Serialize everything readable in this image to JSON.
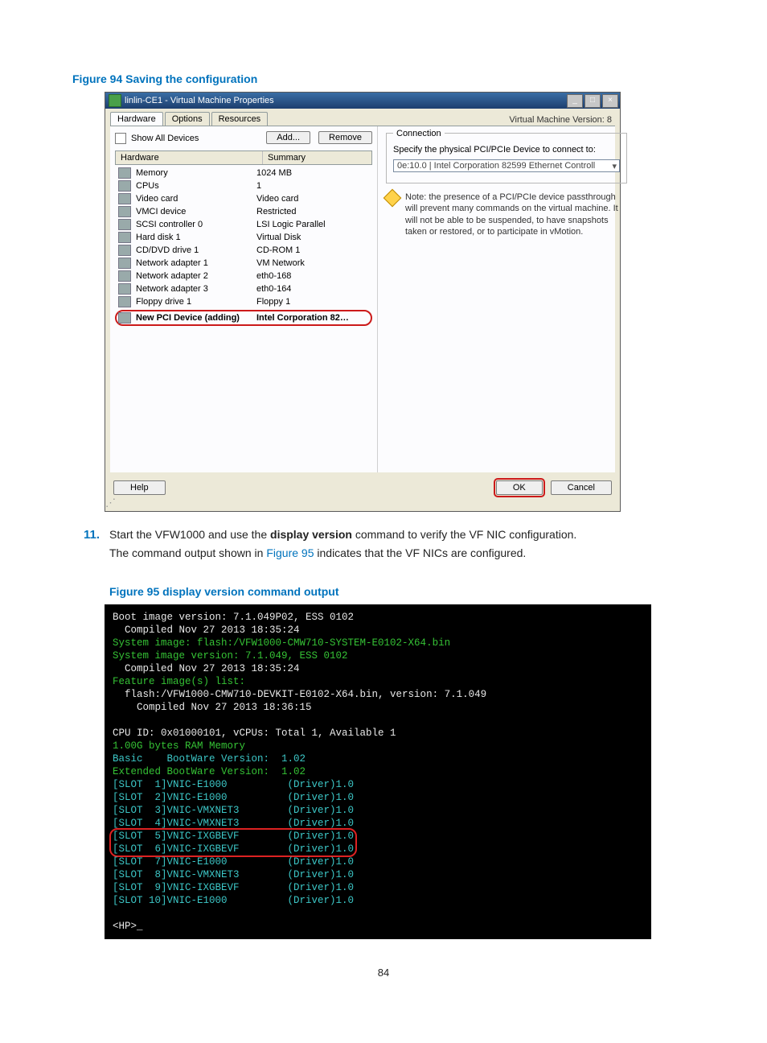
{
  "figure94": {
    "label": "Figure 94 Saving the configuration"
  },
  "dialog": {
    "title": "linlin-CE1 - Virtual Machine Properties",
    "vm_version": "Virtual Machine Version: 8",
    "tabs": {
      "hardware": "Hardware",
      "options": "Options",
      "resources": "Resources"
    },
    "show_all": "Show All Devices",
    "add": "Add...",
    "remove": "Remove",
    "col_hw": "Hardware",
    "col_sum": "Summary",
    "rows": [
      {
        "name": "Memory",
        "sum": "1024 MB"
      },
      {
        "name": "CPUs",
        "sum": "1"
      },
      {
        "name": "Video card",
        "sum": "Video card"
      },
      {
        "name": "VMCI device",
        "sum": "Restricted"
      },
      {
        "name": "SCSI controller 0",
        "sum": "LSI Logic Parallel"
      },
      {
        "name": "Hard disk 1",
        "sum": "Virtual Disk"
      },
      {
        "name": "CD/DVD drive 1",
        "sum": "CD-ROM 1"
      },
      {
        "name": "Network adapter 1",
        "sum": "VM Network"
      },
      {
        "name": "Network adapter 2",
        "sum": "eth0-168"
      },
      {
        "name": "Network adapter 3",
        "sum": "eth0-164"
      },
      {
        "name": "Floppy drive 1",
        "sum": "Floppy 1"
      }
    ],
    "new_row": {
      "name": "New PCI Device (adding)",
      "sum": "Intel Corporation 82…"
    },
    "conn_legend": "Connection",
    "conn_desc": "Specify the physical PCI/PCIe Device to connect to:",
    "conn_select": "0e:10.0 | Intel Corporation 82599 Ethernet Controll",
    "warn": "Note: the presence of a PCI/PCIe device passthrough will prevent many commands on the virtual machine. It will not be able to be suspended, to have snapshots taken or restored, or to participate in vMotion.",
    "help": "Help",
    "ok": "OK",
    "cancel": "Cancel"
  },
  "step": {
    "num": "11.",
    "line1a": "Start the VFW1000 and use the ",
    "line1b": "display version",
    "line1c": " command to verify the VF NIC configuration.",
    "line2a": "The command output shown in ",
    "line2link": "Figure 95",
    "line2b": " indicates that the VF NICs are configured."
  },
  "figure95": {
    "label": "Figure 95 display version command output"
  },
  "term": {
    "l1": "Boot image version: 7.1.049P02, ESS 0102",
    "l2": "  Compiled Nov 27 2013 18:35:24",
    "l3": "System image: flash:/VFW1000-CMW710-SYSTEM-E0102-X64.bin",
    "l4": "System image version: 7.1.049, ESS 0102",
    "l5": "  Compiled Nov 27 2013 18:35:24",
    "l6": "Feature image(s) list:",
    "l7": "  flash:/VFW1000-CMW710-DEVKIT-E0102-X64.bin, version: 7.1.049",
    "l8": "    Compiled Nov 27 2013 18:36:15",
    "l9": "CPU ID: 0x01000101, vCPUs: Total 1, Available 1",
    "l10": "1.00G bytes RAM Memory",
    "l11": "Basic    BootWare Version:  1.02",
    "l12": "Extended BootWare Version:  1.02",
    "s1": "[SLOT  1]VNIC-E1000          (Driver)1.0",
    "s2": "[SLOT  2]VNIC-E1000          (Driver)1.0",
    "s3": "[SLOT  3]VNIC-VMXNET3        (Driver)1.0",
    "s4": "[SLOT  4]VNIC-VMXNET3        (Driver)1.0",
    "s5": "[SLOT  5]VNIC-IXGBEVF        (Driver)1.0",
    "s6": "[SLOT  6]VNIC-IXGBEVF        (Driver)1.0",
    "s7": "[SLOT  7]VNIC-E1000          (Driver)1.0",
    "s8": "[SLOT  8]VNIC-VMXNET3        (Driver)1.0",
    "s9": "[SLOT  9]VNIC-IXGBEVF        (Driver)1.0",
    "s10": "[SLOT 10]VNIC-E1000          (Driver)1.0",
    "prompt": "<HP>_"
  },
  "pagenum": "84"
}
